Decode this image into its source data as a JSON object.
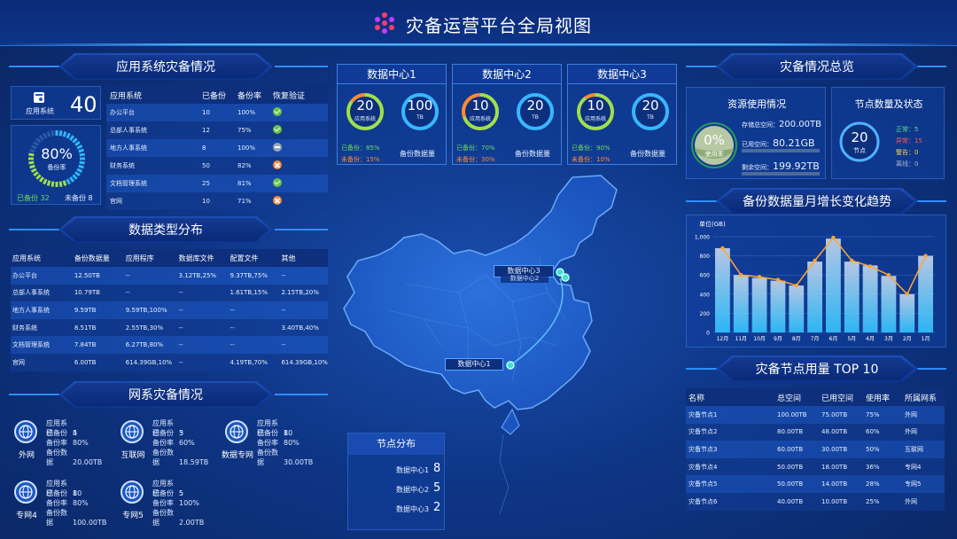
{
  "header": {
    "title": "灾备运营平台全局视图"
  },
  "left_top": {
    "banner": "应用系统灾备情况",
    "app_label": "应用系统",
    "app_count": "40",
    "ring_pct": "80%",
    "ring_label": "备份率",
    "ring_value": 0.8,
    "backed_label": "已备份 32",
    "unbacked_label": "未备份 8",
    "table": {
      "headers": [
        "应用系统",
        "已备份",
        "备份率",
        "恢复验证"
      ],
      "rows": [
        {
          "name": "办公平台",
          "count": "10",
          "rate": "100%",
          "status": "check"
        },
        {
          "name": "总部人事系统",
          "count": "12",
          "rate": "75%",
          "status": "check"
        },
        {
          "name": "地方人事系统",
          "count": "8",
          "rate": "100%",
          "status": "minus"
        },
        {
          "name": "财务系统",
          "count": "50",
          "rate": "82%",
          "status": "x"
        },
        {
          "name": "文档管理系统",
          "count": "25",
          "rate": "81%",
          "status": "check"
        },
        {
          "name": "官网",
          "count": "10",
          "rate": "71%",
          "status": "x"
        }
      ]
    }
  },
  "data_types": {
    "banner": "数据类型分布",
    "headers": [
      "应用系统",
      "备份数据量",
      "应用程序",
      "数据库文件",
      "配置文件",
      "其他"
    ],
    "rows": [
      [
        "办公平台",
        "12.50TB",
        "--",
        "3.12TB,25%",
        "9.37TB,75%",
        "--"
      ],
      [
        "总部人事系统",
        "10.79TB",
        "--",
        "--",
        "1.61TB,15%",
        "2.15TB,20%"
      ],
      [
        "地方人事系统",
        "9.59TB",
        "9.59TB,100%",
        "--",
        "--",
        "--"
      ],
      [
        "财务系统",
        "8.51TB",
        "2.55TB,30%",
        "--",
        "--",
        "3.40TB,40%"
      ],
      [
        "文档管理系统",
        "7.84TB",
        "6.27TB,80%",
        "--",
        "--",
        "--"
      ],
      [
        "官网",
        "6.00TB",
        "614.39GB,10%",
        "--",
        "4.19TB,70%",
        "614.39GB,10%"
      ]
    ]
  },
  "network": {
    "banner": "网系灾备情况",
    "keys": [
      "应用系统",
      "已备份",
      "备份率",
      "备份数据"
    ],
    "items": [
      {
        "name": "外网",
        "vals": [
          "5",
          "4",
          "80%",
          "20.00TB"
        ]
      },
      {
        "name": "互联网",
        "vals": [
          "5",
          "3",
          "60%",
          "18.59TB"
        ]
      },
      {
        "name": "数据专网",
        "vals": [
          "10",
          "8",
          "80%",
          "30.00TB"
        ]
      },
      {
        "name": "专网4",
        "vals": [
          "10",
          "8",
          "80%",
          "100.00TB"
        ]
      },
      {
        "name": "专网5",
        "vals": [
          "5",
          "5",
          "100%",
          "2.00TB"
        ]
      }
    ]
  },
  "datacenters": [
    {
      "title": "数据中心1",
      "app_num": "20",
      "app_label": "应用系统",
      "tb_num": "100",
      "tb_unit": "TB",
      "backed": "已备份：85%",
      "unbacked": "未备份：15%",
      "backed_frac": 0.85,
      "vol_label": "备份数据量"
    },
    {
      "title": "数据中心2",
      "app_num": "10",
      "app_label": "应用系统",
      "tb_num": "20",
      "tb_unit": "TB",
      "backed": "已备份：70%",
      "unbacked": "未备份：30%",
      "backed_frac": 0.7,
      "vol_label": "备份数据量"
    },
    {
      "title": "数据中心3",
      "app_num": "10",
      "app_label": "应用系统",
      "tb_num": "20",
      "tb_unit": "TB",
      "backed": "已备份：90%",
      "unbacked": "未备份：10%",
      "backed_frac": 0.9,
      "vol_label": "备份数据量"
    }
  ],
  "map": {
    "labels": [
      "数据中心3",
      "数据中心2",
      "数据中心1"
    ]
  },
  "nodes": {
    "title": "节点分布",
    "rows": [
      {
        "label": "数据中心1",
        "value": "8"
      },
      {
        "label": "数据中心2",
        "value": "5"
      },
      {
        "label": "数据中心3",
        "value": "2"
      }
    ]
  },
  "overview": {
    "banner": "灾备情况总览",
    "resource": {
      "title": "资源使用情况",
      "pct": "0%",
      "pct_label": "使用率",
      "total_label": "存储总空间：",
      "total": "200.00TB",
      "used_label": "已用空间：",
      "used": "80.21GB",
      "free_label": "剩余空间：",
      "free": "199.92TB",
      "used_frac": 0.0004
    },
    "status": {
      "title": "节点数量及状态",
      "num": "20",
      "num_label": "节点",
      "items": [
        {
          "label": "正常：5",
          "color": "#5fe08a"
        },
        {
          "label": "异常：15",
          "color": "#ff5a4a"
        },
        {
          "label": "警告：0",
          "color": "#ffd23f"
        },
        {
          "label": "离线：0",
          "color": "#a9b7cc"
        }
      ]
    }
  },
  "trend": {
    "banner": "备份数据量月增长变化趋势"
  },
  "chart_data": {
    "type": "bar",
    "ylabel": "单位(GB)",
    "ylim": [
      0,
      1000
    ],
    "yticks": [
      "0",
      "200",
      "400",
      "600",
      "800",
      "1,000"
    ],
    "categories": [
      "12月",
      "11月",
      "10月",
      "9月",
      "8月",
      "7月",
      "6月",
      "5月",
      "4月",
      "3月",
      "2月",
      "1月"
    ],
    "series": [
      {
        "type": "bar",
        "values": [
          880,
          600,
          570,
          540,
          490,
          740,
          980,
          740,
          700,
          590,
          400,
          800
        ]
      },
      {
        "type": "line",
        "values": [
          880,
          600,
          580,
          550,
          490,
          750,
          990,
          750,
          690,
          600,
          400,
          800
        ]
      }
    ]
  },
  "top10": {
    "banner": "灾备节点用量 TOP 10",
    "headers": [
      "名称",
      "总空间",
      "已用空间",
      "使用率",
      "所属网系"
    ],
    "rows": [
      [
        "灾备节点1",
        "100.00TB",
        "75.00TB",
        "75%",
        "外网"
      ],
      [
        "灾备节点2",
        "80.00TB",
        "48.00TB",
        "60%",
        "外网"
      ],
      [
        "灾备节点3",
        "60.00TB",
        "30.00TB",
        "50%",
        "互联网"
      ],
      [
        "灾备节点4",
        "50.00TB",
        "18.00TB",
        "36%",
        "专网4"
      ],
      [
        "灾备节点5",
        "50.00TB",
        "14.00TB",
        "28%",
        "专网5"
      ],
      [
        "灾备节点6",
        "40.00TB",
        "10.00TB",
        "25%",
        "外网"
      ]
    ]
  }
}
